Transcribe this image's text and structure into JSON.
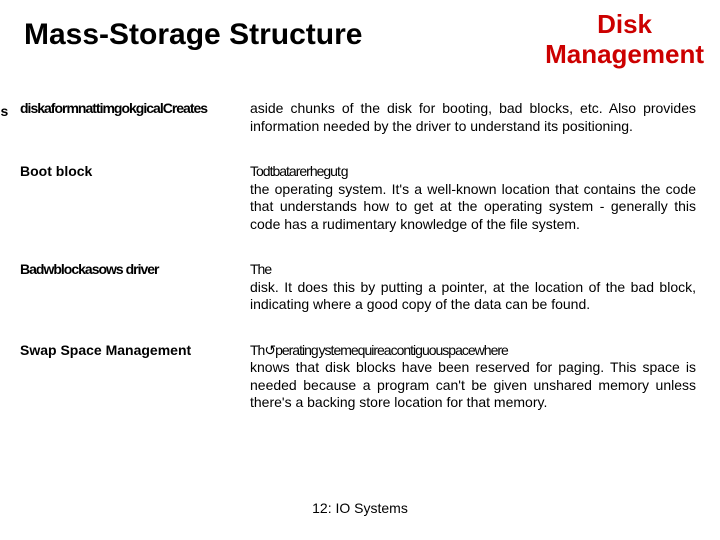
{
  "header": {
    "main_title": "Mass-Storage Structure",
    "right_title_line1": "Disk",
    "right_title_line2": "Management"
  },
  "edge_text": "gs",
  "rows": [
    {
      "label_garbled": "diskaformnattimgokgicalCreates",
      "lead": "",
      "desc": "aside chunks of the disk for booting, bad blocks, etc.  Also provides information needed by the driver to understand its positioning."
    },
    {
      "label_garbled": "Boot block",
      "lead": "Todtbatarerhegut g",
      "desc": "the operating system.  It's a well-known location that contains the code that understands how to get at the operating system - generally this code has a rudimentary knowledge of the file system."
    },
    {
      "label_garbled": "Badwblockasows    driver",
      "lead": "The",
      "desc": "disk.  It does this by putting a pointer, at the location of the bad block, indicating where a good copy of the data can be found."
    },
    {
      "label_garbled": "Swap Space Management",
      "lead": "Th&#8634;perating ystemequireacontiguouspacewhere",
      "desc": "knows that disk blocks have been reserved for paging.  This space is needed because a program can't be given unshared memory unless there's a backing store location for that memory."
    }
  ],
  "footer": "12: IO Systems"
}
